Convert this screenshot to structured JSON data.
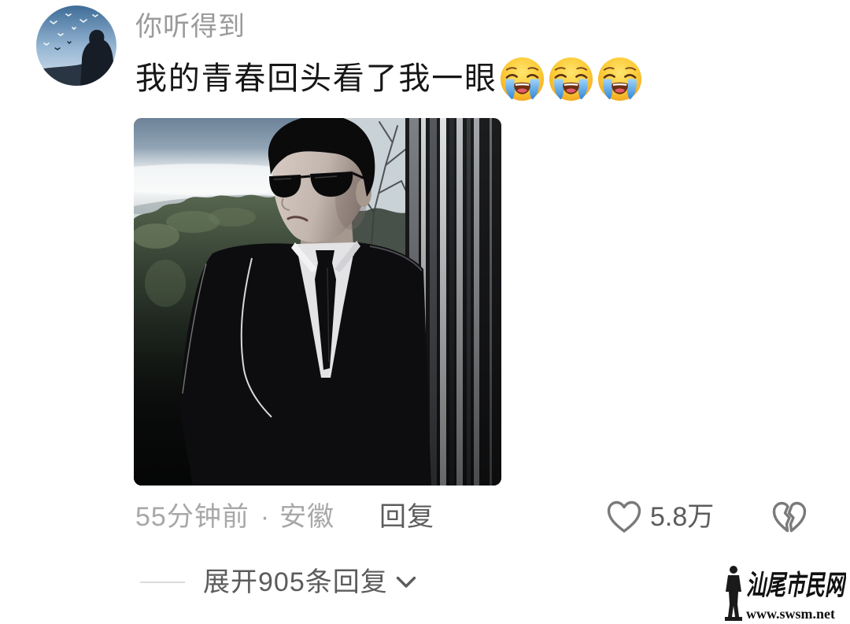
{
  "comment": {
    "username": "你听得到",
    "text": "我的青春回头看了我一眼",
    "emojis": [
      "loudly-crying-face",
      "loudly-crying-face",
      "loudly-crying-face"
    ],
    "time": "55分钟前",
    "separator": "·",
    "location": "安徽",
    "reply_label": "回复",
    "like_count": "5.8万"
  },
  "replies": {
    "expand_label": "展开905条回复"
  },
  "icons": {
    "like": "heart-outline-icon",
    "dislike": "broken-heart-icon",
    "expand": "chevron-down-icon"
  },
  "watermark": {
    "name": "汕尾市民网",
    "url": "www.swsm.net"
  },
  "colors": {
    "username": "#9a9a9a",
    "text": "#161616",
    "meta": "#a8a8a8",
    "action": "#5c5c5c",
    "icon": "#7a7a7a",
    "divider": "#dadada"
  }
}
